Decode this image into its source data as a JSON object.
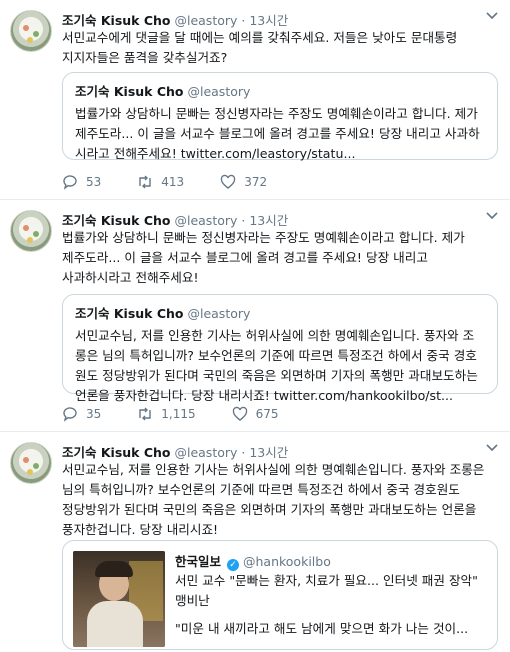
{
  "tweets": [
    {
      "name": "조기숙 Kisuk Cho",
      "handle": "@leastory",
      "sep": "·",
      "time": "13시간",
      "text": "서민교수에게 댓글을 달 때에는 예의를 갖춰주세요. 저들은 낮아도 문대통령 지지자들은 품격을 갖추실거죠?",
      "quote": {
        "name": "조기숙 Kisuk Cho",
        "handle": "@leastory",
        "text": "법률가와 상담하니 문빠는 정신병자라는 주장도 명예훼손이라고 합니다. 제가 제주도라... 이 글을 서교수 블로그에 올려 경고를 주세요! 당장 내리고 사과하시라고 전해주세요! twitter.com/leastory/statu..."
      },
      "stats": {
        "replies": "53",
        "retweets": "413",
        "likes": "372"
      }
    },
    {
      "name": "조기숙 Kisuk Cho",
      "handle": "@leastory",
      "sep": "·",
      "time": "13시간",
      "text": "법률가와 상담하니 문빠는 정신병자라는 주장도 명예훼손이라고 합니다. 제가 제주도라... 이 글을 서교수 블로그에 올려 경고를 주세요! 당장 내리고 사과하시라고 전해주세요!",
      "quote": {
        "name": "조기숙 Kisuk Cho",
        "handle": "@leastory",
        "text": "서민교수님, 저를 인용한 기사는 허위사실에 의한 명예훼손입니다. 풍자와 조롱은 님의 특허입니까? 보수언론의 기준에 따르면 특정조건 하에서 중국 경호원도 정당방위가 된다며 국민의 죽음은 외면하며 기자의 폭행만 과대보도하는 언론을 풍자한겁니다. 당장 내리시죠! twitter.com/hankookilbo/st..."
      },
      "stats": {
        "replies": "35",
        "retweets": "1,115",
        "likes": "675"
      }
    },
    {
      "name": "조기숙 Kisuk Cho",
      "handle": "@leastory",
      "sep": "·",
      "time": "13시간",
      "text": "서민교수님, 저를 인용한 기사는 허위사실에 의한 명예훼손입니다. 풍자와 조롱은 님의 특허입니까? 보수언론의 기준에 따르면 특정조건 하에서 중국 경호원도 정당방위가 된다며 국민의 죽음은 외면하며 기자의 폭행만 과대보도하는 언론을 풍자한겁니다. 당장 내리시죠!",
      "media_quote": {
        "name": "한국일보",
        "handle": "@hankookilbo",
        "title": "서민 교수 \"문빠는 환자, 치료가 필요... 인터넷 패권 장악\" 맹비난",
        "desc": "\"미운 내 새끼라고 해도 남에게 맞으면 화가 나는 것이..."
      }
    }
  ],
  "icons": {
    "reply": "reply-icon",
    "retweet": "retweet-icon",
    "like": "heart-icon",
    "caret": "chevron-down-icon",
    "verified": "verified-badge-icon"
  },
  "colors": {
    "accent": "#1da1f2",
    "muted": "#657786",
    "border": "#e6ecf0"
  }
}
